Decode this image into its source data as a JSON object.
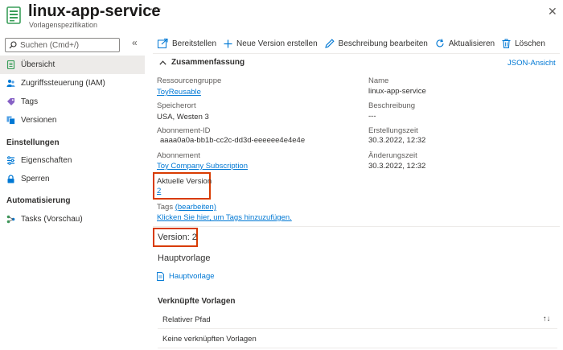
{
  "header": {
    "title": "linux-app-service",
    "subtitle": "Vorlagenspezifikation",
    "more": "···",
    "close": "✕"
  },
  "sidebar": {
    "search_placeholder": "Suchen (Cmd+/)",
    "collapse": "«",
    "items": [
      {
        "label": "Übersicht",
        "icon": "overview-icon"
      },
      {
        "label": "Zugriffssteuerung (IAM)",
        "icon": "people-icon"
      },
      {
        "label": "Tags",
        "icon": "tag-icon"
      },
      {
        "label": "Versionen",
        "icon": "versions-icon"
      }
    ],
    "section_settings": "Einstellungen",
    "settings_items": [
      {
        "label": "Eigenschaften",
        "icon": "properties-icon"
      },
      {
        "label": "Sperren",
        "icon": "lock-icon"
      }
    ],
    "section_automation": "Automatisierung",
    "automation_items": [
      {
        "label": "Tasks (Vorschau)",
        "icon": "tasks-icon"
      }
    ]
  },
  "toolbar": {
    "deploy": "Bereitstellen",
    "new_version": "Neue Version erstellen",
    "edit_desc": "Beschreibung bearbeiten",
    "refresh": "Aktualisieren",
    "delete": "Löschen"
  },
  "essentials": {
    "toggle": "Zusammenfassung",
    "json_view": "JSON-Ansicht",
    "resource_group_label": "Ressourcengruppe",
    "resource_group_value": "ToyReusable",
    "location_label": "Speicherort",
    "location_value": "USA, Westen 3",
    "subscription_id_label": "Abonnement-ID",
    "subscription_id_value": "aaaa0a0a-bb1b-cc2c-dd3d-eeeeee4e4e4e",
    "subscription_label": "Abonnement",
    "subscription_value": "Toy Company Subscription",
    "current_version_label": "Aktuelle Version",
    "current_version_value": "2",
    "tags_label": "Tags",
    "tags_edit": "(bearbeiten)",
    "tags_add": "Klicken Sie hier, um Tags hinzuzufügen.",
    "name_label": "Name",
    "name_value": "linux-app-service",
    "description_label": "Beschreibung",
    "description_value": "---",
    "created_label": "Erstellungszeit",
    "created_value": "30.3.2022, 12:32",
    "modified_label": "Änderungszeit",
    "modified_value": "30.3.2022, 12:32"
  },
  "version_section": {
    "version_title": "Version: 2",
    "main_template_title": "Hauptvorlage",
    "main_template_link": "Hauptvorlage",
    "linked_title": "Verknüpfte Vorlagen",
    "col_relative_path": "Relativer Pfad",
    "sort": "↑↓",
    "empty_row": "Keine verknüpften Vorlagen"
  },
  "colors": {
    "accent": "#0078d4",
    "highlight": "#d83b01",
    "active_bg": "#edebe9"
  }
}
